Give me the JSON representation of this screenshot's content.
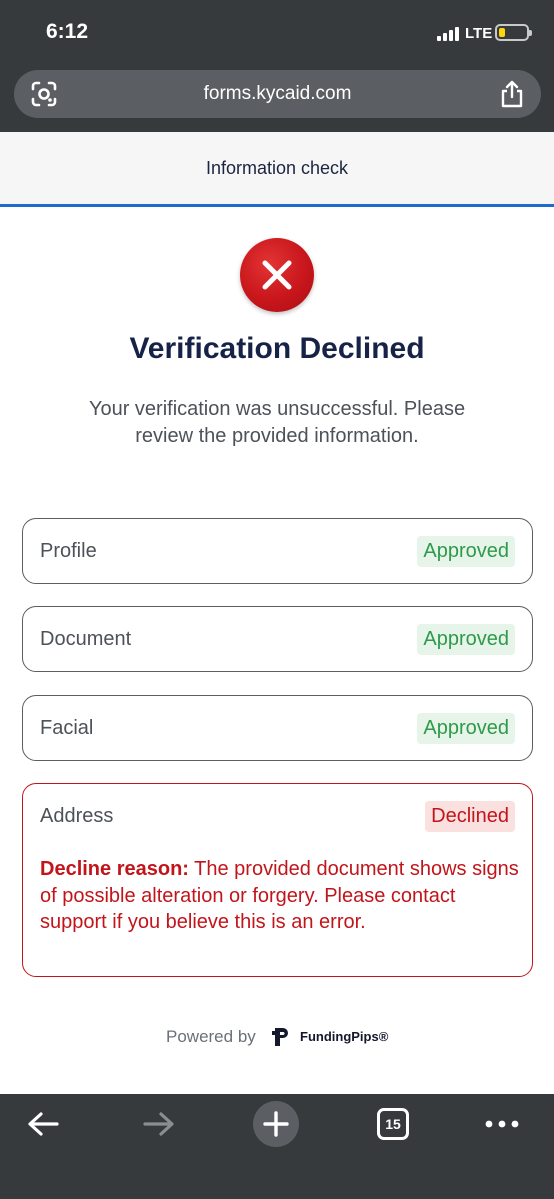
{
  "status_bar": {
    "time": "6:12",
    "network": "LTE"
  },
  "browser": {
    "url": "forms.kycaid.com"
  },
  "page_header": {
    "title": "Information check"
  },
  "result": {
    "heading": "Verification Declined",
    "subtitle": "Your verification was unsuccessful. Please review the provided information."
  },
  "checks": [
    {
      "label": "Profile",
      "status": "Approved"
    },
    {
      "label": "Document",
      "status": "Approved"
    },
    {
      "label": "Facial",
      "status": "Approved"
    },
    {
      "label": "Address",
      "status": "Declined",
      "reason_label": "Decline reason:",
      "reason_text": " The provided document shows signs of possible alteration or forgery. Please contact support if you believe this is an error."
    }
  ],
  "footer": {
    "powered_by": "Powered by",
    "brand": "FundingPips®"
  },
  "bottom_bar": {
    "tab_count": "15"
  },
  "colors": {
    "approved": "#2e9a4a",
    "declined": "#c2151b",
    "accent": "#1e6bc9"
  }
}
